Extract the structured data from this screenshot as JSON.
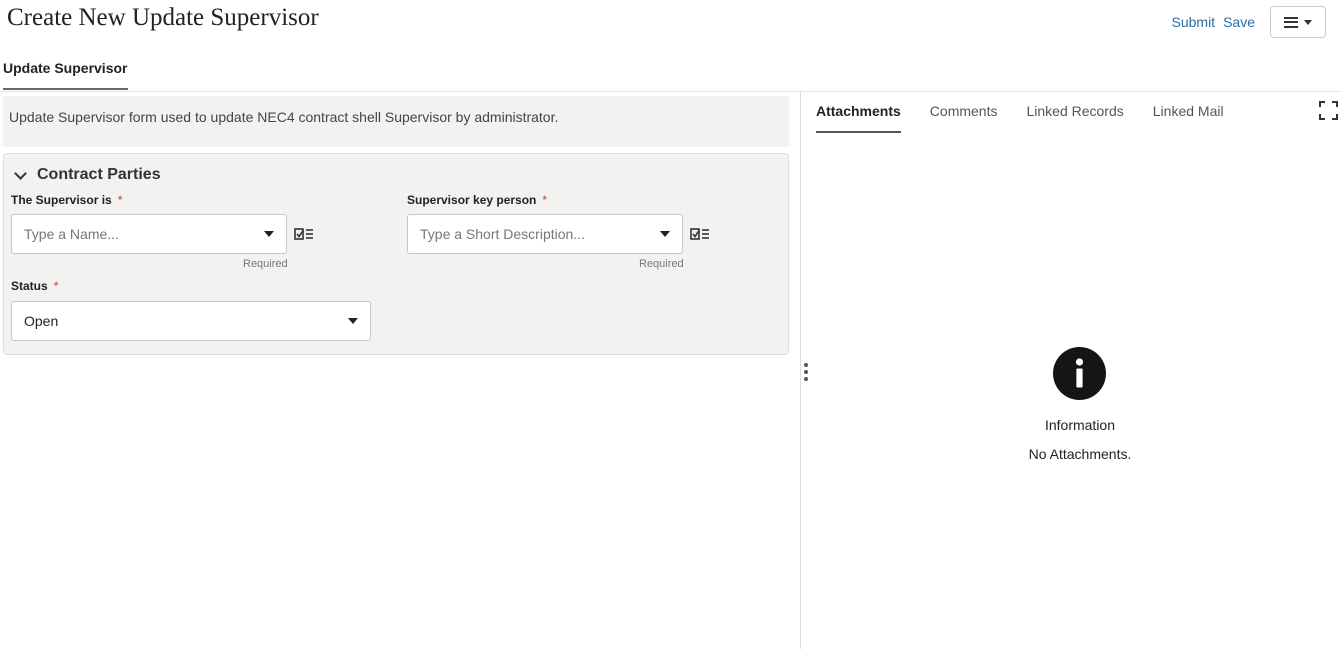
{
  "page": {
    "title": "Create New Update Supervisor"
  },
  "header": {
    "submit_label": "Submit",
    "save_label": "Save",
    "menu_icon": "hamburger-menu-icon"
  },
  "main_tab": {
    "label": "Update Supervisor"
  },
  "description": "Update Supervisor form used to update NEC4 contract shell Supervisor by administrator.",
  "section": {
    "title": "Contract Parties",
    "fields": {
      "supervisor": {
        "label": "The Supervisor is",
        "required_mark": "*",
        "placeholder": "Type a Name...",
        "helper": "Required"
      },
      "key_person": {
        "label": "Supervisor key person",
        "required_mark": "*",
        "placeholder": "Type a Short Description...",
        "helper": "Required"
      },
      "status": {
        "label": "Status",
        "required_mark": "*",
        "value": "Open"
      }
    }
  },
  "right_panel": {
    "tabs": [
      "Attachments",
      "Comments",
      "Linked Records",
      "Linked Mail"
    ],
    "active_tab": "Attachments",
    "info": {
      "title": "Information",
      "message": "No Attachments."
    }
  },
  "colors": {
    "link": "#2a6ea6",
    "required": "#c0392b",
    "panel_bg": "#f3f2f1"
  }
}
